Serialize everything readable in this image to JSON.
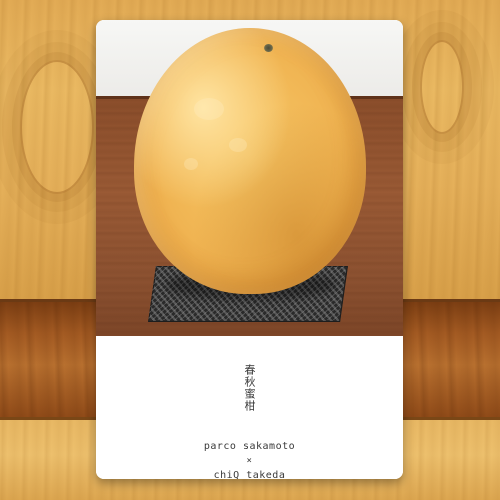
{
  "card": {
    "title": "春秋蜜柑",
    "credits": {
      "line1": "parco sakamoto",
      "separator": "×",
      "line2": "chiQ takeda"
    }
  },
  "colors": {
    "fruit": "#f0b452",
    "table": "#8b4e2b",
    "wood_light": "#e8b864",
    "wood_dark": "#a35a22",
    "card": "#ffffff"
  }
}
